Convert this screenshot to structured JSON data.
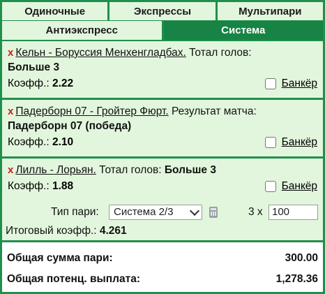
{
  "tabs_row1": [
    {
      "label": "Одиночные"
    },
    {
      "label": "Экспрессы"
    },
    {
      "label": "Мультипари"
    }
  ],
  "tabs_row2": [
    {
      "label": "Антиэкспресс"
    },
    {
      "label": "Система",
      "active": true
    }
  ],
  "bets": [
    {
      "remove": "x",
      "teams": "Кельн - Боруссия Менхенгладбах.",
      "market": " Тотал голов:",
      "selection": "Больше 3",
      "coef_label": "Коэфф.:",
      "coef": "2.22",
      "banker_label": "Банкёр",
      "banker_checked": false
    },
    {
      "remove": "x",
      "teams": "Падерборн 07 - Гройтер Фюрт.",
      "market": " Результат матча:",
      "selection": "Падерборн 07 (победа)",
      "coef_label": "Коэфф.:",
      "coef": "2.10",
      "banker_label": "Банкёр",
      "banker_checked": false
    },
    {
      "remove": "x",
      "teams": "Лилль - Лорьян.",
      "market": " Тотал голов: ",
      "selection": "Больше 3",
      "coef_label": "Коэфф.:",
      "coef": "1.88",
      "banker_label": "Банкёр",
      "banker_checked": false
    }
  ],
  "system": {
    "bet_type_label": "Тип пари:",
    "bet_type_value": "Система 2/3",
    "calculator_icon": "calculator-icon",
    "multiplier": "3 x",
    "stake_value": "100",
    "total_coef_label": "Итоговый коэфф.:",
    "total_coef": "4.261"
  },
  "summary": {
    "total_stake_label": "Общая сумма пари:",
    "total_stake": "300.00",
    "potential_payout_label": "Общая потенц. выплата:",
    "potential_payout": "1,278.36"
  },
  "colors": {
    "frame": "#1f8f4d",
    "panel": "#e2f6dd",
    "active_tab": "#178445",
    "remove_x": "#d11a1a"
  }
}
